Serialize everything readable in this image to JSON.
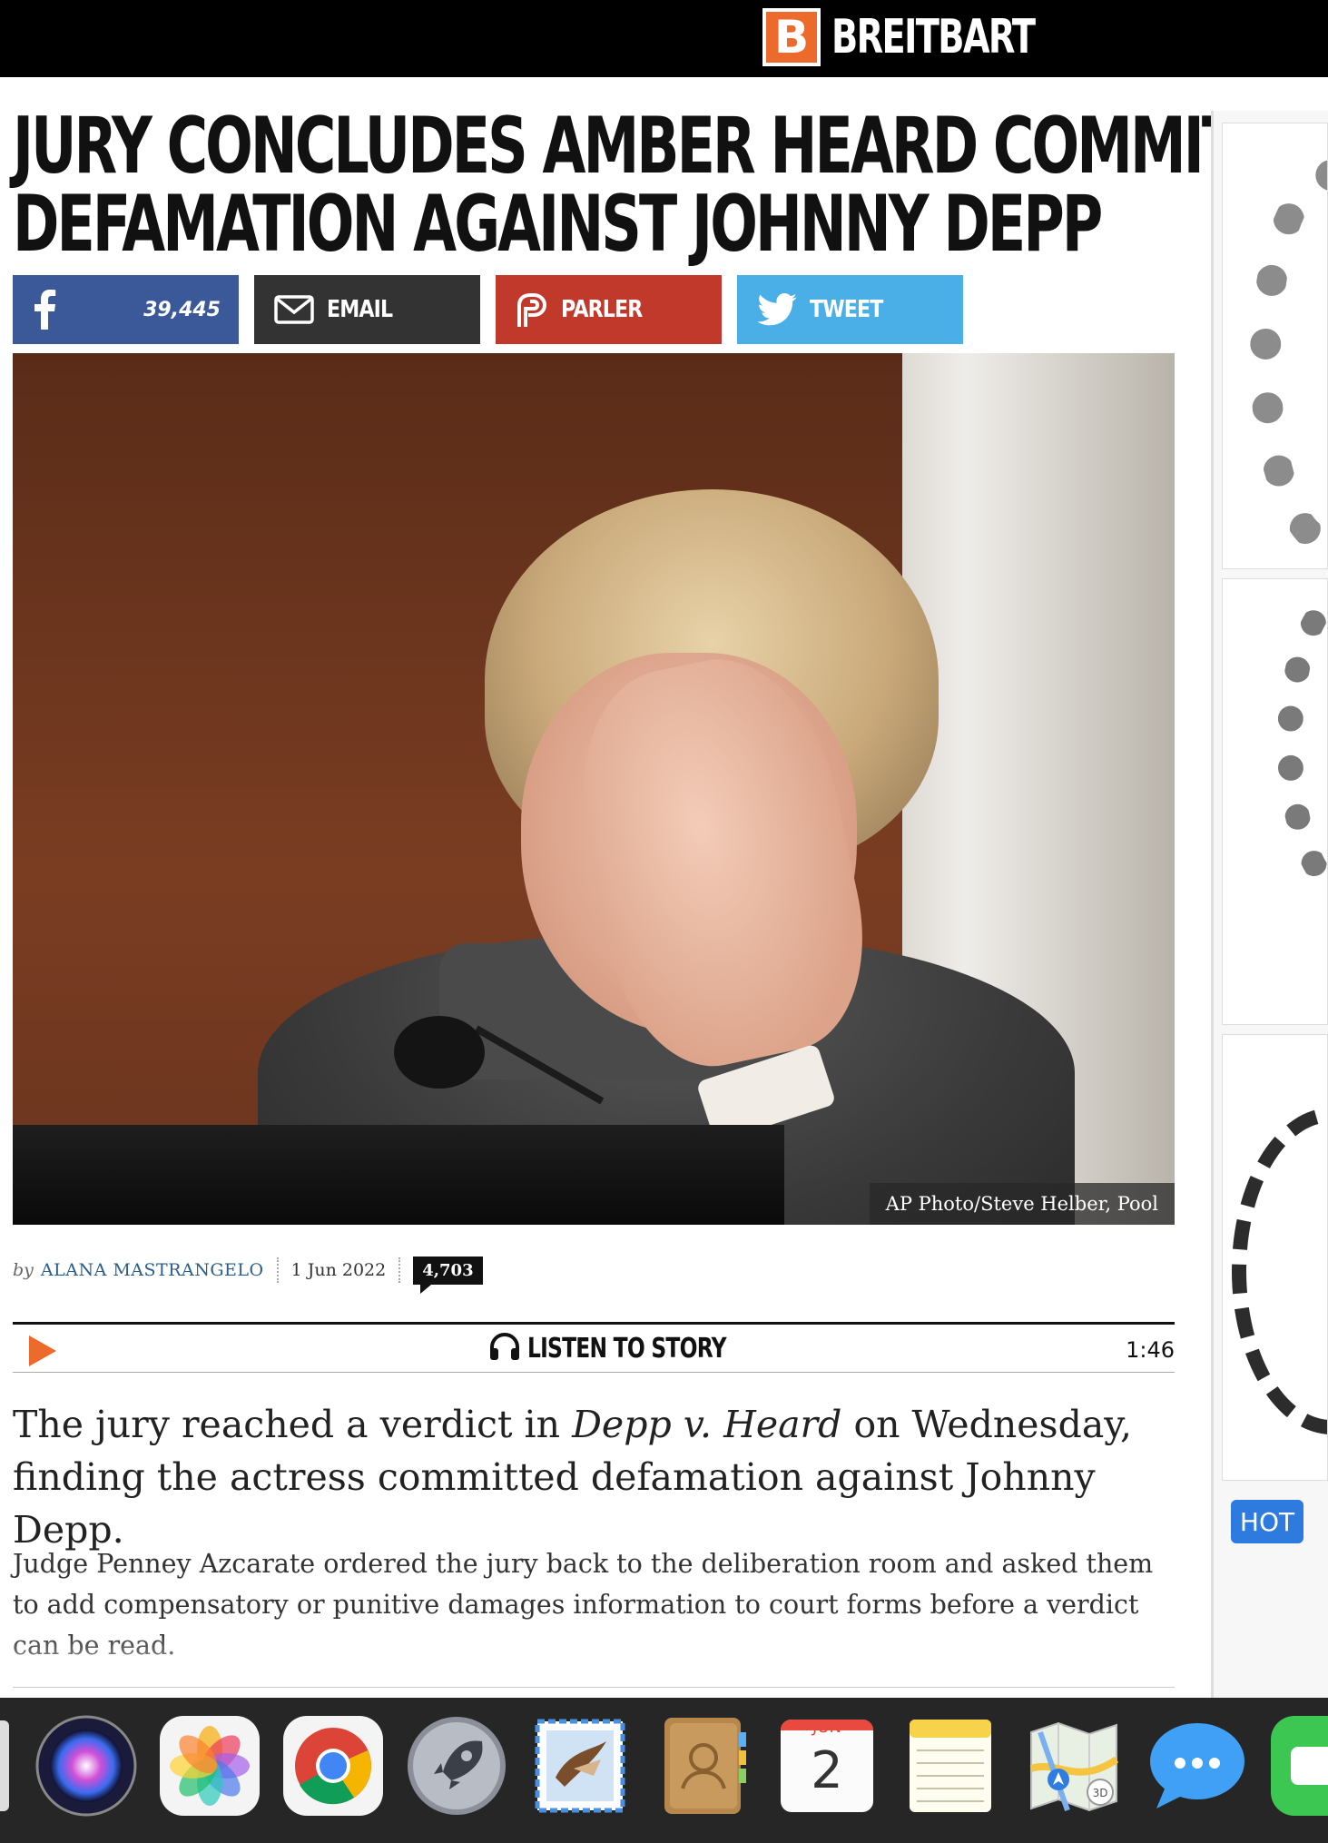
{
  "site": {
    "logo_letter": "B",
    "logo_text": "BREITBART"
  },
  "article": {
    "headline_line1": "JURY CONCLUDES AMBER HEARD COMMITTED",
    "headline_line2": "DEFAMATION AGAINST JOHNNY DEPP",
    "share": {
      "facebook_count": "39,445",
      "email_label": "EMAIL",
      "parler_label": "PARLER",
      "tweet_label": "TWEET"
    },
    "photo_caption": "AP Photo/Steve Helber, Pool",
    "byline": {
      "by": "by",
      "author": "ALANA MASTRANGELO",
      "date": "1 Jun 2022",
      "comment_count": "4,703"
    },
    "listen": {
      "label": "LISTEN TO STORY",
      "duration": "1:46"
    },
    "lead_pre": "The jury reached a verdict in ",
    "lead_italic": "Depp v. Heard",
    "lead_post": " on Wednesday, finding the actress committed defamation against Johnny Depp.",
    "paragraph": "Judge Penney Azcarate ordered the jury back to the deliberation room and asked them to add compensatory or punitive damages information to court forms before a verdict can be read."
  },
  "sidebar": {
    "hot_badge": "HOT"
  },
  "dock": {
    "calendar_month": "JUN",
    "calendar_day": "2",
    "items": [
      "siri-icon",
      "photos-icon",
      "chrome-icon",
      "launchpad-icon",
      "mail-icon",
      "contacts-icon",
      "calendar-icon",
      "notes-icon",
      "maps-icon",
      "messages-icon",
      "facetime-icon"
    ]
  },
  "colors": {
    "brand_orange": "#ec6a2c",
    "facebook": "#3b5998",
    "email": "#333333",
    "parler": "#c0392b",
    "twitter": "#4aaee7",
    "hot_badge": "#2e7be0"
  }
}
